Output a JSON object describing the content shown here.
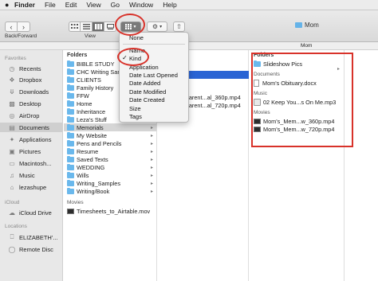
{
  "menubar": {
    "apple": "",
    "items": [
      "Finder",
      "File",
      "Edit",
      "View",
      "Go",
      "Window",
      "Help"
    ]
  },
  "toolbar": {
    "back_forward_label": "Back/Forward",
    "view_label": "View",
    "window_title": "Mom"
  },
  "path_strip": {
    "title": "Mom"
  },
  "sidebar": {
    "favorites_label": "Favorites",
    "favorites": [
      {
        "label": "Recents",
        "icon": "clock-icon"
      },
      {
        "label": "Dropbox",
        "icon": "dropbox-icon"
      },
      {
        "label": "Downloads",
        "icon": "downloads-icon"
      },
      {
        "label": "Desktop",
        "icon": "desktop-icon"
      },
      {
        "label": "Documents",
        "icon": "documents-icon"
      },
      {
        "label": "AirDrop",
        "icon": "airdrop-icon"
      },
      {
        "label": "Applications",
        "icon": "applications-icon"
      },
      {
        "label": "Pictures",
        "icon": "pictures-icon"
      },
      {
        "label": "Macintosh...",
        "icon": "harddisk-icon"
      },
      {
        "label": "Music",
        "icon": "music-icon"
      },
      {
        "label": "lezashupe",
        "icon": "home-icon"
      }
    ],
    "icloud_label": "iCloud",
    "icloud": [
      {
        "label": "iCloud Drive",
        "icon": "cloud-icon"
      }
    ],
    "locations_label": "Locations",
    "locations": [
      {
        "label": "ELIZABETH'...",
        "icon": "computer-icon"
      },
      {
        "label": "Remote Disc",
        "icon": "disc-icon"
      }
    ]
  },
  "column1": {
    "header": "Folders",
    "folders": [
      "BIBLE STUDY",
      "CHC Writing Sam",
      "CLIENTS",
      "Family History",
      "FFW",
      "Home",
      "Inheritance",
      "Leza's Stuff",
      "Memorials",
      "My Website",
      "Pens and Pencils",
      "Resume",
      "Saved Texts",
      "WEDDING",
      "Wills",
      "Writing_Samples",
      "Writing/Book"
    ],
    "movies_header": "Movies",
    "movies": [
      "Timesheets_to_Airtable.mov"
    ]
  },
  "column2": {
    "visible_items": [
      "Parent...al_360p.mp4",
      "Parent...al_720p.mp4"
    ]
  },
  "column3": {
    "folders_header": "Folders",
    "folders": [
      "Slideshow Pics"
    ],
    "documents_header": "Documents",
    "documents": [
      "Mom's Obituary.docx"
    ],
    "music_header": "Music",
    "music": [
      "02 Keep You...s On Me.mp3"
    ],
    "movies_header": "Movies",
    "movies": [
      "Mom's_Mem...w_360p.mp4",
      "Mom's_Mem...w_720p.mp4"
    ]
  },
  "arrange_menu": {
    "items": [
      "None",
      "Name",
      "Kind",
      "Application",
      "Date Last Opened",
      "Date Added",
      "Date Modified",
      "Date Created",
      "Size",
      "Tags"
    ],
    "checked": "Kind"
  },
  "colors": {
    "selection": "#2a64d4",
    "folder": "#6ab8ec",
    "annotation": "#d8322a"
  }
}
